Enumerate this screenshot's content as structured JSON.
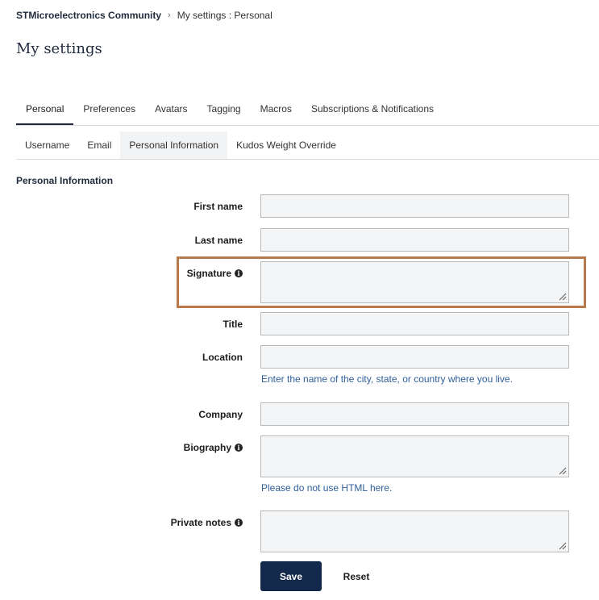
{
  "breadcrumb": {
    "root": "STMicroelectronics Community",
    "separator": "›",
    "current": "My settings : Personal"
  },
  "page": {
    "title": "My settings"
  },
  "tabs": [
    {
      "label": "Personal",
      "active": true
    },
    {
      "label": "Preferences"
    },
    {
      "label": "Avatars"
    },
    {
      "label": "Tagging"
    },
    {
      "label": "Macros"
    },
    {
      "label": "Subscriptions & Notifications"
    }
  ],
  "subtabs": [
    {
      "label": "Username"
    },
    {
      "label": "Email"
    },
    {
      "label": "Personal Information",
      "active": true
    },
    {
      "label": "Kudos Weight Override"
    }
  ],
  "section": {
    "title": "Personal Information"
  },
  "fields": {
    "first_name": {
      "label": "First name",
      "value": ""
    },
    "last_name": {
      "label": "Last name",
      "value": ""
    },
    "signature": {
      "label": "Signature",
      "value": "",
      "icon": "info-icon"
    },
    "title": {
      "label": "Title",
      "value": ""
    },
    "location": {
      "label": "Location",
      "value": "",
      "help": "Enter the name of the city, state, or country where you live."
    },
    "company": {
      "label": "Company",
      "value": ""
    },
    "biography": {
      "label": "Biography",
      "value": "",
      "icon": "info-icon",
      "help": "Please do not use HTML here."
    },
    "private_notes": {
      "label": "Private notes",
      "value": "",
      "icon": "info-icon"
    }
  },
  "buttons": {
    "save": "Save",
    "reset": "Reset"
  },
  "colors": {
    "primary": "#13294b",
    "highlight": "#b87a4b",
    "link": "#2f5f9a"
  }
}
